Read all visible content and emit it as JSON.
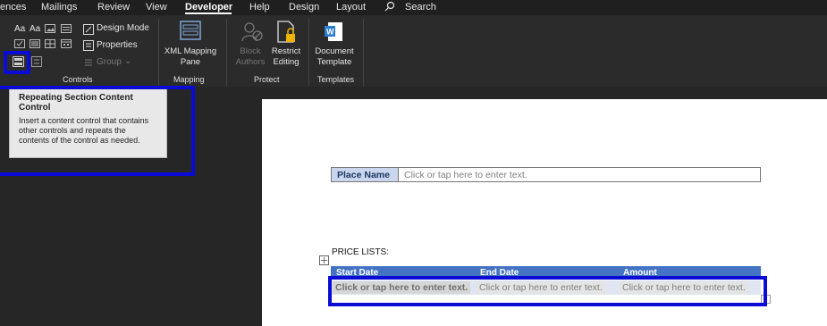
{
  "tabs": [
    {
      "label": "ences",
      "active": false
    },
    {
      "label": "Mailings",
      "active": false
    },
    {
      "label": "Review",
      "active": false
    },
    {
      "label": "View",
      "active": false
    },
    {
      "label": "Developer",
      "active": true
    },
    {
      "label": "Help",
      "active": false
    },
    {
      "label": "Design",
      "active": false
    },
    {
      "label": "Layout",
      "active": false
    }
  ],
  "search": {
    "label": "Search",
    "icon": "search-icon"
  },
  "ribbon": {
    "controls": {
      "group_label": "Controls",
      "design_mode": "Design Mode",
      "properties": "Properties",
      "group": "Group",
      "aa_rich": "Aa",
      "aa_plain": "Aa"
    },
    "mapping": {
      "group_label": "Mapping",
      "xml_mapping_line1": "XML Mapping",
      "xml_mapping_line2": "Pane"
    },
    "protect": {
      "group_label": "Protect",
      "block_line1": "Block",
      "block_line2": "Authors",
      "restrict_line1": "Restrict",
      "restrict_line2": "Editing"
    },
    "templates": {
      "group_label": "Templates",
      "doc_template_line1": "Document",
      "doc_template_line2": "Template"
    }
  },
  "tooltip": {
    "title": "Repeating Section Content Control",
    "body": "Insert a content control that contains other controls and repeats the contents of the control as needed."
  },
  "document": {
    "place_name_label": "Place Name",
    "place_name_value": "Click or tap here to enter text.",
    "price_lists_title": "PRICE LISTS:",
    "price_headers": [
      "Start Date",
      "End Date",
      "Amount"
    ],
    "price_row": [
      "Click or tap here to enter text.",
      "Click or tap here to enter text.",
      "Click or tap here to enter text."
    ]
  },
  "colors": {
    "highlight": "#0b0bd6",
    "table_header": "#4472c4",
    "label_cell": "#c9d6ee"
  }
}
